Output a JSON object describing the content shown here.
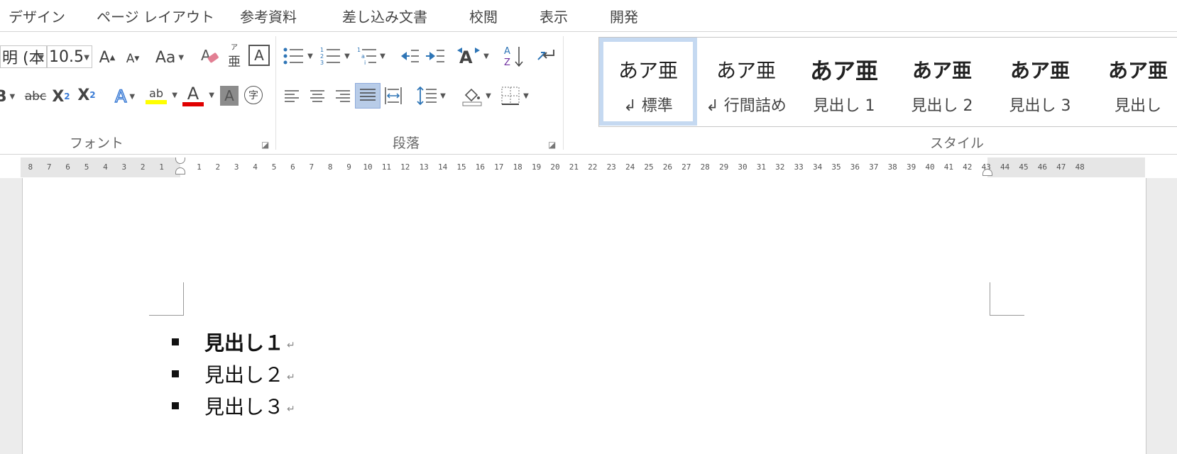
{
  "tabs": [
    {
      "label": "デザイン"
    },
    {
      "label": "ページ レイアウト"
    },
    {
      "label": "参考資料"
    },
    {
      "label": "差し込み文書"
    },
    {
      "label": "校閲"
    },
    {
      "label": "表示"
    },
    {
      "label": "開発"
    }
  ],
  "font_group": {
    "label": "フォント",
    "font_name": "明 (本",
    "font_size": "10.5",
    "grow_glyph": "A",
    "shrink_glyph": "A",
    "case_glyph": "Aa",
    "phonetic_glyph": "亜",
    "border_glyph": "A",
    "bold_glyph": "B",
    "strike_glyph": "abc",
    "sub_glyph": "X",
    "sub_mark": "2",
    "sup_glyph": "X",
    "sup_mark": "2",
    "effects_glyph": "A",
    "highlight_glyph": "ab",
    "font_color_glyph": "A",
    "shading_glyph": "A",
    "enclose_glyph": "字"
  },
  "paragraph_group": {
    "label": "段落",
    "sort_glyph": "AZ"
  },
  "styles_group": {
    "label": "スタイル",
    "items": [
      {
        "sample": "あア亜",
        "name": "↲ 標準"
      },
      {
        "sample": "あア亜",
        "name": "↲ 行間詰め"
      },
      {
        "sample": "あア亜",
        "name": "見出し 1"
      },
      {
        "sample": "あア亜",
        "name": "見出し 2"
      },
      {
        "sample": "あア亜",
        "name": "見出し 3"
      },
      {
        "sample": "あア亜",
        "name": "見出し"
      }
    ]
  },
  "ruler": {
    "left_numbers": [
      "8",
      "7",
      "6",
      "5",
      "4",
      "3",
      "2",
      "1"
    ],
    "right_numbers": [
      "1",
      "2",
      "3",
      "4",
      "5",
      "6",
      "7",
      "8",
      "9",
      "10",
      "11",
      "12",
      "13",
      "14",
      "15",
      "16",
      "17",
      "18",
      "19",
      "20",
      "21",
      "22",
      "23",
      "24",
      "25",
      "26",
      "27",
      "28",
      "29",
      "30",
      "31",
      "32",
      "33",
      "34",
      "35",
      "36",
      "37",
      "38",
      "39",
      "40",
      "41",
      "42",
      "43",
      "44",
      "45",
      "46",
      "47",
      "48"
    ]
  },
  "document": {
    "list": [
      {
        "text": "見出し１",
        "mark": "↵"
      },
      {
        "text": "見出し２",
        "mark": "↵"
      },
      {
        "text": "見出し３",
        "mark": "↵"
      }
    ]
  },
  "colors": {
    "highlight": "#ffff00",
    "font_color": "#e00000",
    "active_style_border": "#c5d9f1",
    "justify_active": "#b8cce8",
    "effects_blue": "#3a7bd5"
  }
}
